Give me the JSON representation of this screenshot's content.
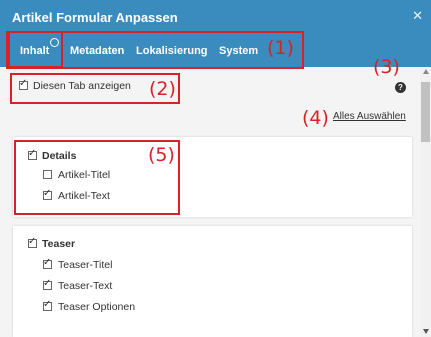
{
  "dialog": {
    "title": "Artikel Formular Anpassen",
    "close_icon": "close-icon"
  },
  "tabs": [
    {
      "label": "Inhalt",
      "active": true
    },
    {
      "label": "Metadaten"
    },
    {
      "label": "Lokalisierung"
    },
    {
      "label": "System"
    }
  ],
  "show_tab": {
    "label": "Diesen Tab anzeigen",
    "checked": true
  },
  "help": {
    "icon": "help-icon",
    "glyph": "?"
  },
  "select_all": {
    "label": "Alles Auswählen"
  },
  "groups": [
    {
      "label": "Details",
      "checked": true,
      "items": [
        {
          "label": "Artikel-Titel",
          "checked": false
        },
        {
          "label": "Artikel-Text",
          "checked": true
        }
      ]
    },
    {
      "label": "Teaser",
      "checked": true,
      "items": [
        {
          "label": "Teaser-Titel",
          "checked": true
        },
        {
          "label": "Teaser-Text",
          "checked": true
        },
        {
          "label": "Teaser Optionen",
          "checked": true
        }
      ]
    }
  ],
  "annotations": [
    "(1)",
    "(2)",
    "(3)",
    "(4)",
    "(5)"
  ],
  "colors": {
    "header": "#3a8cbe",
    "highlight": "#d7222a",
    "content_bg": "#f4f4f4"
  }
}
